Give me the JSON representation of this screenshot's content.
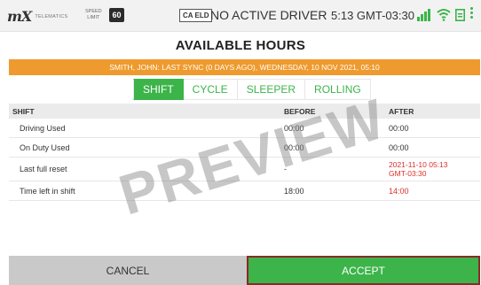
{
  "status_bar": {
    "logo_text": "mX",
    "logo_sub": "TELEMATICS",
    "speed_label_line1": "SPEED",
    "speed_label_line2": "LIMIT",
    "speed_limit": "60",
    "eld_badge": "CA ELD",
    "driver_status": "NO ACTIVE DRIVER",
    "clock": "5:13 GMT-03:30",
    "icons": [
      "signal-icon",
      "wifi-icon",
      "sd-card-icon",
      "overflow-menu-icon"
    ],
    "accent_color": "#3cb44a"
  },
  "title": "AVAILABLE HOURS",
  "banner": {
    "text": "SMITH, JOHN: LAST SYNC (0 DAYS AGO), WEDNESDAY, 10 NOV 2021, 05:10",
    "color": "#ef9a2e"
  },
  "tabs": [
    {
      "label": "SHIFT",
      "active": true
    },
    {
      "label": "CYCLE",
      "active": false
    },
    {
      "label": "SLEEPER",
      "active": false
    },
    {
      "label": "ROLLING",
      "active": false
    }
  ],
  "table": {
    "headers": [
      "SHIFT",
      "BEFORE",
      "AFTER"
    ],
    "rows": [
      {
        "label": "Driving Used",
        "before": "00:00",
        "after": "00:00"
      },
      {
        "label": "On Duty Used",
        "before": "00:00",
        "after": "00:00"
      },
      {
        "label": "Last full reset",
        "before": "-",
        "after_line1": "2021-11-10 05:13",
        "after_line2": "GMT-03:30"
      },
      {
        "label": "Time left in shift",
        "before": "18:00",
        "after": "14:00"
      }
    ]
  },
  "watermark": "PREVIEW",
  "buttons": {
    "cancel": "CANCEL",
    "accept": "ACCEPT"
  }
}
